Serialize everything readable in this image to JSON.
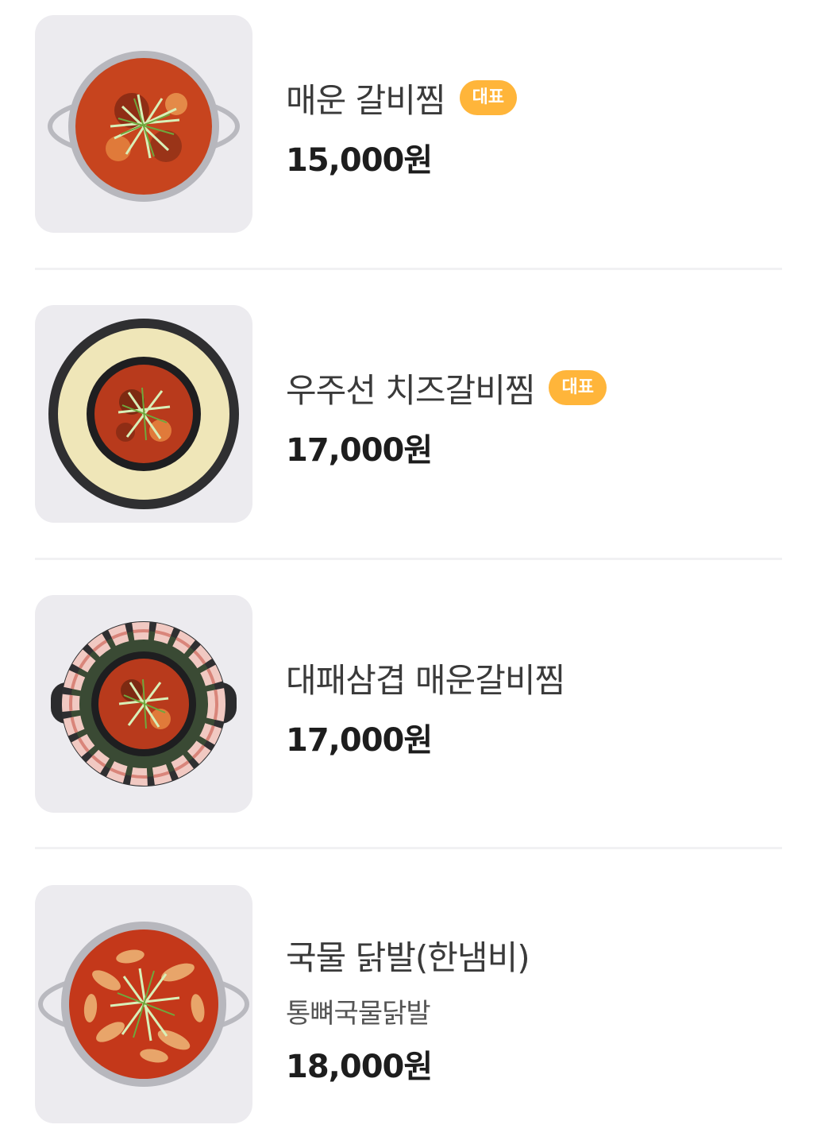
{
  "menu": {
    "items": [
      {
        "name": "매운 갈비찜",
        "badge": "대표",
        "price": "15,000원",
        "image": "spicy-galbijjim-pot-photo"
      },
      {
        "name": "우주선 치즈갈비찜",
        "badge": "대표",
        "price": "17,000원",
        "image": "spaceship-cheese-galbijjim-photo"
      },
      {
        "name": "대패삼겹 매운갈비찜",
        "price": "17,000원",
        "image": "pork-belly-spicy-galbijjim-photo"
      },
      {
        "name": "국물 닭발(한냄비)",
        "description": "통뼈국물닭발",
        "price": "18,000원",
        "image": "chicken-feet-soup-pot-photo"
      }
    ]
  },
  "colors": {
    "badge": "#ffb53a",
    "thumb_bg": "#ecebef",
    "price_text": "#1d1d1d"
  }
}
